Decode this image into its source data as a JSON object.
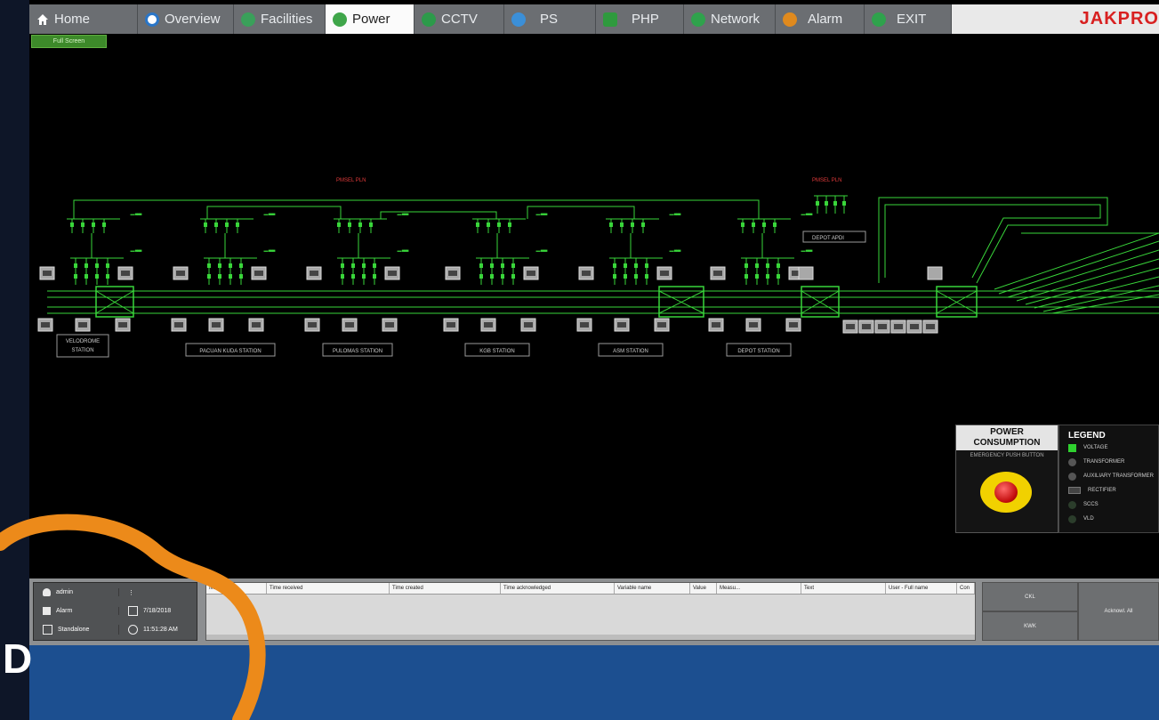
{
  "nav": {
    "tabs": [
      {
        "label": "Home",
        "icon": "home-icon",
        "color": "#ffffff",
        "active": false
      },
      {
        "label": "Overview",
        "icon": "overview-icon",
        "color": "#2a76c8",
        "active": false
      },
      {
        "label": "Facilities",
        "icon": "facilities-icon",
        "color": "#3aa05a",
        "active": false
      },
      {
        "label": "Power",
        "icon": "power-icon",
        "color": "#3fa64a",
        "active": true
      },
      {
        "label": "CCTV",
        "icon": "cctv-icon",
        "color": "#2c9a4a",
        "active": false
      },
      {
        "label": "PS",
        "icon": "ps-icon",
        "color": "#3b8fd8",
        "active": false
      },
      {
        "label": "PHP",
        "icon": "php-icon",
        "color": "#2f9a3e",
        "active": false
      },
      {
        "label": "Network",
        "icon": "network-icon",
        "color": "#2fa24c",
        "active": false
      },
      {
        "label": "Alarm",
        "icon": "alarm-icon",
        "color": "#e08a1e",
        "active": false
      },
      {
        "label": "EXIT",
        "icon": "exit-icon",
        "color": "#2fa24c",
        "active": false
      }
    ],
    "brand": "JAKPRO"
  },
  "fullscreen_label": "Full Screen",
  "diagram": {
    "stations": [
      "VELODROME STATION",
      "PACUAN KUDA STATION",
      "PULOMAS STATION",
      "KGB STATION",
      "ASM STATION",
      "DEPOT STATION"
    ],
    "red_labels": [
      "PMSEL PLN",
      "PMSEL PLN"
    ],
    "depot_label": "DEPOT APDI",
    "accent_color": "#39d63a"
  },
  "power_panel": {
    "title": "POWER CONSUMPTION",
    "subtitle": "EMERGENCY PUSH BUTTON"
  },
  "legend": {
    "title": "LEGEND",
    "items": [
      {
        "label": "VOLTAGE",
        "color": "#2fd12f"
      },
      {
        "label": "TRANSFORMER",
        "color": "#555555"
      },
      {
        "label": "AUXILIARY TRANSFORMER",
        "color": "#555555"
      },
      {
        "label": "RECTIFIER",
        "color": "#444444"
      },
      {
        "label": "SCCS",
        "color": "#2b3d2b"
      },
      {
        "label": "VLD",
        "color": "#2b3d2b"
      }
    ]
  },
  "status": {
    "user": "admin",
    "mode": "Alarm",
    "date": "7/18/2018",
    "role": "Standalone",
    "time": "11:51:28 AM"
  },
  "alarm_table": {
    "columns": [
      "Ivar...",
      "Time received",
      "Time created",
      "Time acknowledged",
      "Variable name",
      "Value",
      "Measu...",
      "Text",
      "User - Full name",
      "Con"
    ]
  },
  "actions": {
    "top": "CKL",
    "bottom": "KWK",
    "right": "Acknowl. All"
  }
}
